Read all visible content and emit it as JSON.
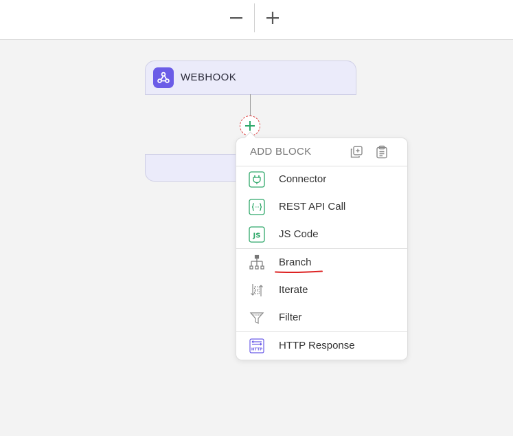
{
  "toolbar": {
    "zoom_out_icon": "minus-icon",
    "zoom_in_icon": "plus-icon"
  },
  "canvas": {
    "trigger_node": {
      "title": "WEBHOOK",
      "icon": "webhook-icon",
      "icon_color": "#6b5ce7"
    },
    "add_button_icon": "plus-icon"
  },
  "add_block_menu": {
    "title": "ADD BLOCK",
    "header_icons": [
      "duplicate-icon",
      "paste-icon"
    ],
    "items": [
      {
        "label": "Connector",
        "icon": "plug-icon"
      },
      {
        "label": "REST API Call",
        "icon": "braces-icon"
      },
      {
        "label": "JS Code",
        "icon": "js-icon"
      },
      {
        "label": "Branch",
        "icon": "branch-icon"
      },
      {
        "label": "Iterate",
        "icon": "iterate-icon"
      },
      {
        "label": "Filter",
        "icon": "filter-icon"
      },
      {
        "label": "HTTP Response",
        "icon": "http-icon"
      }
    ]
  },
  "colors": {
    "accent_green": "#2fa86a",
    "accent_purple": "#6b5ce7",
    "annotation_red": "#d22"
  }
}
